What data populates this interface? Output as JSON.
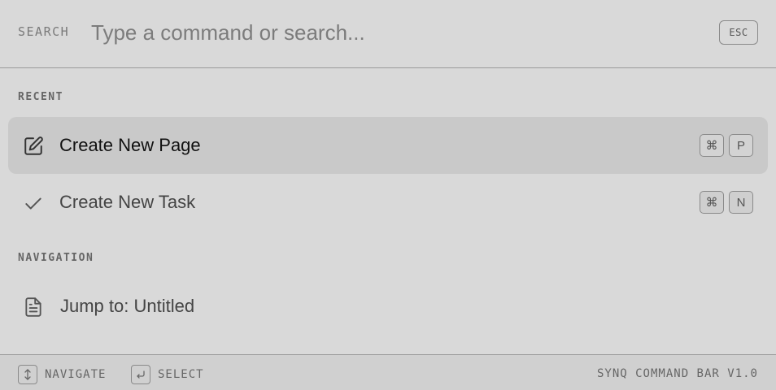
{
  "search": {
    "label": "SEARCH",
    "placeholder": "Type a command or search...",
    "value": "",
    "esc_label": "ESC"
  },
  "sections": {
    "recent_label": "RECENT",
    "navigation_label": "NAVIGATION"
  },
  "items": [
    {
      "label": "Create New Page",
      "icon": "edit-icon",
      "keys": [
        "⌘",
        "P"
      ],
      "active": true
    },
    {
      "label": "Create New Task",
      "icon": "check-icon",
      "keys": [
        "⌘",
        "N"
      ],
      "active": false
    },
    {
      "label": "Jump to: Untitled",
      "icon": "document-icon",
      "keys": [],
      "active": false
    }
  ],
  "footer": {
    "navigate_label": "NAVIGATE",
    "navigate_icon": "up-down-arrow-icon",
    "select_label": "SELECT",
    "select_icon": "enter-icon",
    "version": "SYNQ COMMAND BAR V1.0"
  }
}
